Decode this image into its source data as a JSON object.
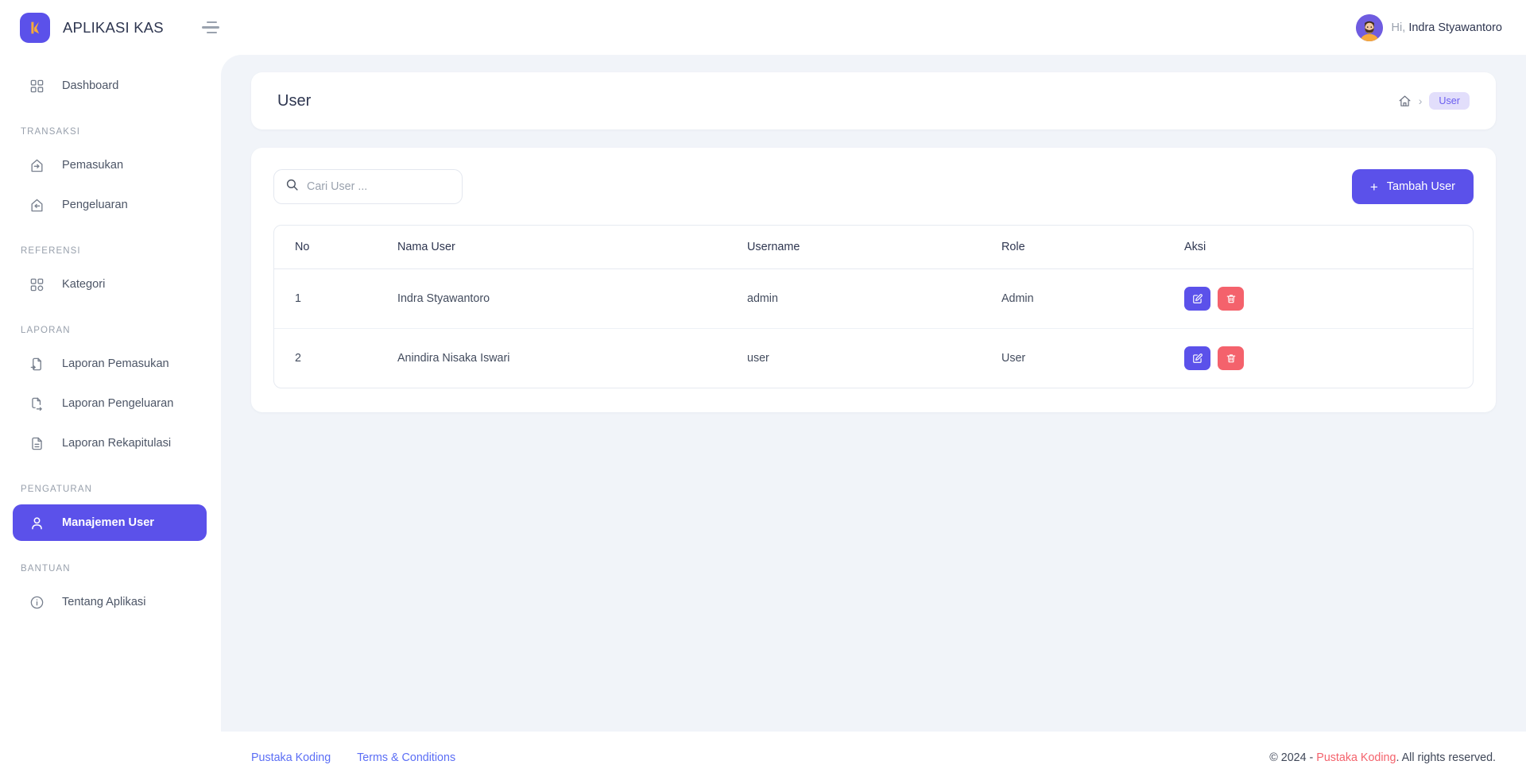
{
  "brand": {
    "name": "APLIKASI KAS",
    "logo_icon": "k-logo-icon",
    "logo_color": "#5b51ea",
    "logo_accent": "#f7a93b"
  },
  "topbar": {
    "menu_toggle_icon": "hamburger-icon",
    "greeting_prefix": "Hi,",
    "user_name": "Indra Styawantoro",
    "avatar_icon": "user-avatar"
  },
  "sidebar": {
    "items": [
      {
        "type": "item",
        "label": "Dashboard",
        "icon": "grid-icon",
        "active": false
      },
      {
        "type": "group",
        "label": "TRANSAKSI"
      },
      {
        "type": "item",
        "label": "Pemasukan",
        "icon": "arrow-in-icon",
        "active": false
      },
      {
        "type": "item",
        "label": "Pengeluaran",
        "icon": "arrow-out-icon",
        "active": false
      },
      {
        "type": "group",
        "label": "REFERENSI"
      },
      {
        "type": "item",
        "label": "Kategori",
        "icon": "grid-icon",
        "active": false
      },
      {
        "type": "group",
        "label": "LAPORAN"
      },
      {
        "type": "item",
        "label": "Laporan Pemasukan",
        "icon": "file-in-icon",
        "active": false
      },
      {
        "type": "item",
        "label": "Laporan Pengeluaran",
        "icon": "file-out-icon",
        "active": false
      },
      {
        "type": "item",
        "label": "Laporan Rekapitulasi",
        "icon": "file-text-icon",
        "active": false
      },
      {
        "type": "group",
        "label": "PENGATURAN"
      },
      {
        "type": "item",
        "label": "Manajemen User",
        "icon": "person-icon",
        "active": true
      },
      {
        "type": "group",
        "label": "BANTUAN"
      },
      {
        "type": "item",
        "label": "Tentang Aplikasi",
        "icon": "info-circle-icon",
        "active": false
      }
    ],
    "active_color": "#5b51ea"
  },
  "page": {
    "title": "User",
    "breadcrumb": {
      "home_icon": "home-icon",
      "separator": "›",
      "current": "User"
    }
  },
  "toolbar": {
    "search": {
      "icon": "search-icon",
      "placeholder": "Cari User ...",
      "value": ""
    },
    "add_button": {
      "label": "Tambah User",
      "icon": "plus-icon",
      "color": "#5b51ea"
    }
  },
  "table": {
    "columns": [
      "No",
      "Nama User",
      "Username",
      "Role",
      "Aksi"
    ],
    "rows": [
      {
        "no": "1",
        "nama_user": "Indra Styawantoro",
        "username": "admin",
        "role": "Admin",
        "actions": [
          {
            "name": "edit-button",
            "icon": "pencil-icon",
            "color": "#5b51ea"
          },
          {
            "name": "delete-button",
            "icon": "trash-icon",
            "color": "#f4626c"
          }
        ]
      },
      {
        "no": "2",
        "nama_user": "Anindira Nisaka Iswari",
        "username": "user",
        "role": "User",
        "actions": [
          {
            "name": "edit-button",
            "icon": "pencil-icon",
            "color": "#5b51ea"
          },
          {
            "name": "delete-button",
            "icon": "trash-icon",
            "color": "#f4626c"
          }
        ]
      }
    ]
  },
  "footer": {
    "links": [
      "Pustaka Koding",
      "Terms & Conditions"
    ],
    "copyright_prefix": "© 2024 - ",
    "copyright_brand": "Pustaka Koding",
    "copyright_suffix": ". All rights reserved."
  }
}
